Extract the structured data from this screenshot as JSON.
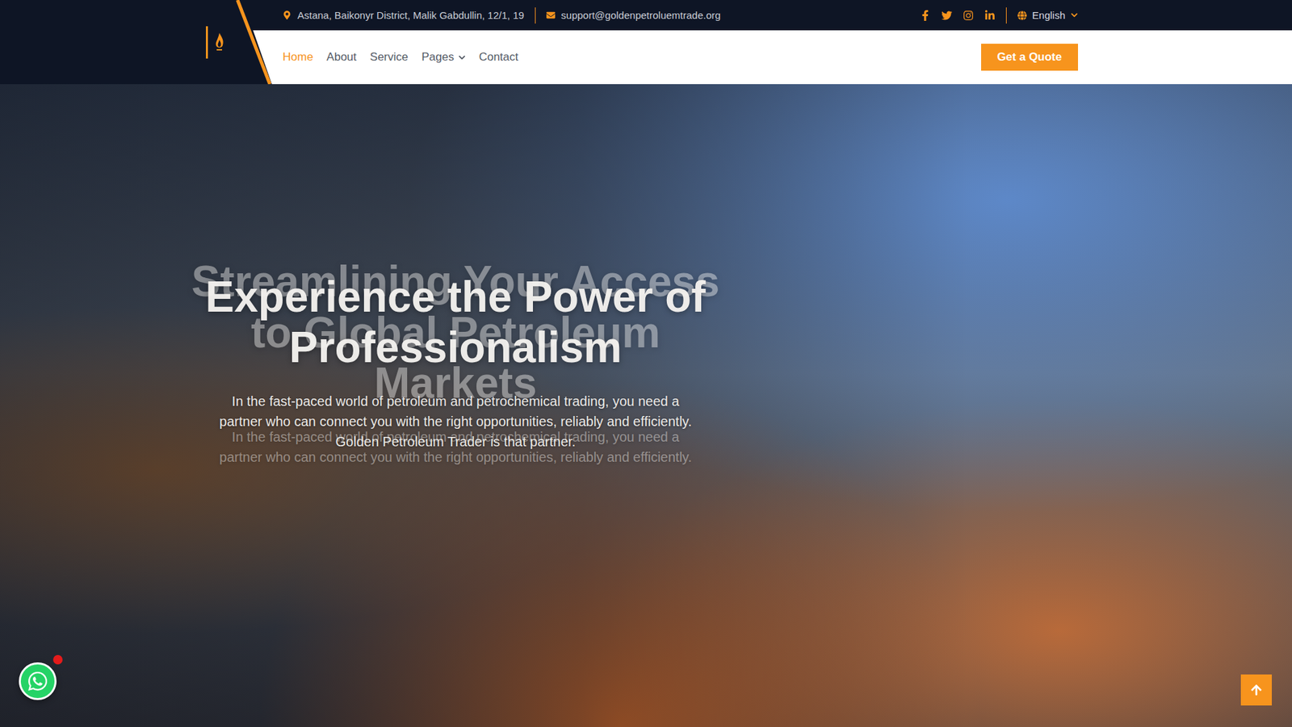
{
  "topbar": {
    "address": "Astana, Baikonyr District, Malik Gabdullin, 12/1, 19",
    "email": "support@goldenpetroluemtrade.org",
    "language": "English"
  },
  "nav": {
    "links": [
      {
        "label": "Home",
        "selected": true,
        "dropdown": false
      },
      {
        "label": "About",
        "selected": false,
        "dropdown": false
      },
      {
        "label": "Service",
        "selected": false,
        "dropdown": false
      },
      {
        "label": "Pages",
        "selected": false,
        "dropdown": true
      },
      {
        "label": "Contact",
        "selected": false,
        "dropdown": false
      }
    ],
    "cta": "Get a Quote"
  },
  "hero": {
    "slides": [
      {
        "title": "Streamlining Your Access to Global Petroleum Markets",
        "text": "In the fast-paced world of petroleum and petrochemical trading, you need a partner who can connect you with the right opportunities, reliably and efficiently.",
        "active": false
      },
      {
        "title": "Experience the Power of Professionalism",
        "text": "In the fast-paced world of petroleum and petrochemical trading, you need a partner who can connect you with the right opportunities, reliably and efficiently. Golden Petroleum Trader is that partner.",
        "active": true
      }
    ]
  },
  "whatsapp": {
    "notification": true
  },
  "scroll_top": {
    "visible": true
  }
}
